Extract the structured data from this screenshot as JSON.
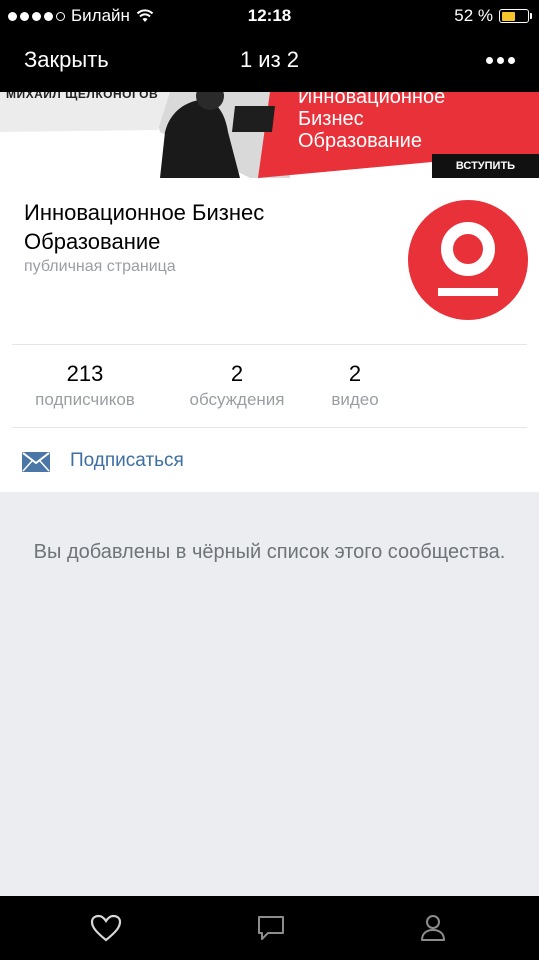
{
  "status_bar": {
    "carrier": "Билайн",
    "time": "12:18",
    "battery_percent": "52 %",
    "battery_level": 0.52,
    "signal_bars_filled": 4
  },
  "nav": {
    "close_label": "Закрыть",
    "title": "1 из 2",
    "more_icon": "more-dots-icon"
  },
  "cover": {
    "person_name": "МИХАИЛ ЩЕЛКОНОГОВ",
    "line1": "Инновационное",
    "line2": "Бизнес",
    "line3": "Образование",
    "join_label": "ВСТУПИТЬ"
  },
  "community": {
    "title": "Инновационное Бизнес Образование",
    "type": "публичная страница",
    "accent_color": "#e9313a"
  },
  "stats": [
    {
      "value": "213",
      "label": "подписчиков"
    },
    {
      "value": "2",
      "label": "обсуждения"
    },
    {
      "value": "2",
      "label": "видео"
    }
  ],
  "subscribe": {
    "label": "Подписаться",
    "icon": "mail-icon",
    "link_color": "#3d6fa3"
  },
  "message": "Вы добавлены в чёрный список этого сообщества.",
  "tabbar": {
    "icons": [
      "heart-icon",
      "comment-icon",
      "profile-icon"
    ]
  }
}
